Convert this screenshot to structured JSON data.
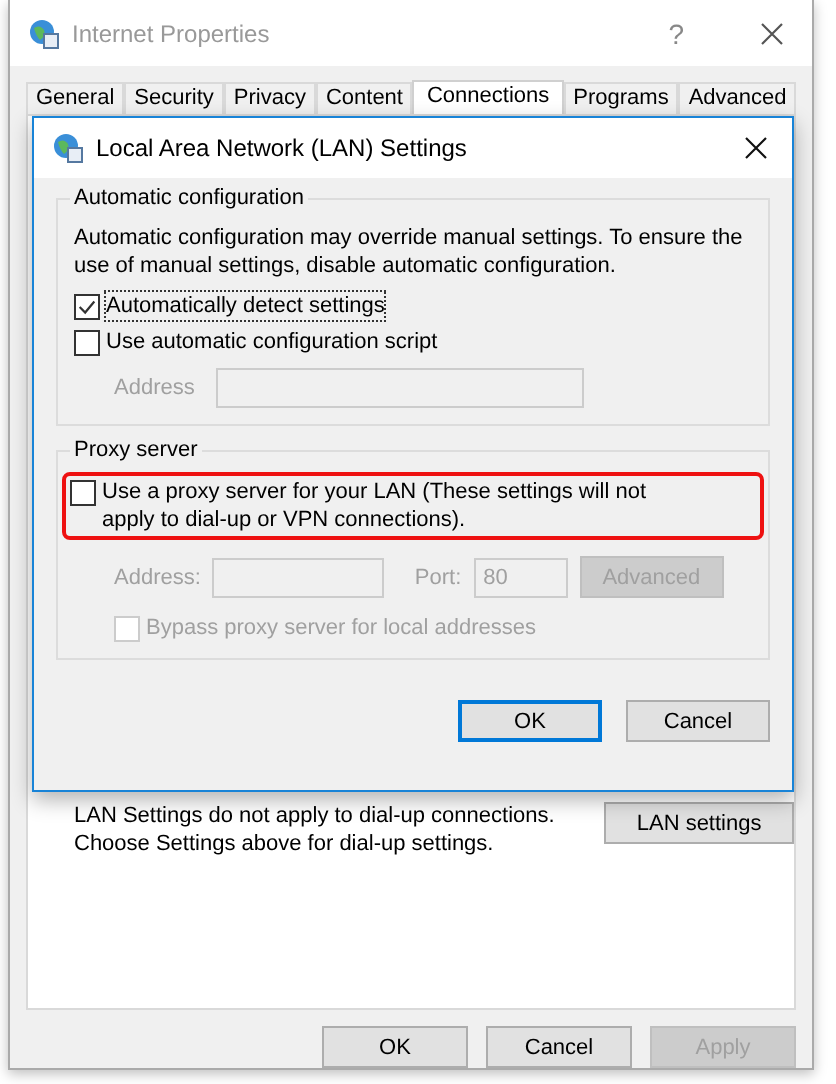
{
  "window": {
    "title": "Internet Properties",
    "help": "?"
  },
  "tabs": [
    {
      "label": "General",
      "selected": false
    },
    {
      "label": "Security",
      "selected": false
    },
    {
      "label": "Privacy",
      "selected": false
    },
    {
      "label": "Content",
      "selected": false
    },
    {
      "label": "Connections",
      "selected": true
    },
    {
      "label": "Programs",
      "selected": false
    },
    {
      "label": "Advanced",
      "selected": false
    }
  ],
  "panel": {
    "note": "LAN Settings do not apply to dial-up connections.\nChoose Settings above for dial-up settings.",
    "lan_button": "LAN settings"
  },
  "dialog": {
    "title": "Local Area Network (LAN) Settings",
    "auto_config": {
      "legend": "Automatic configuration",
      "description": "Automatic configuration may override manual settings.  To ensure the use of manual settings, disable automatic configuration.",
      "options": [
        {
          "label": "Automatically detect settings",
          "checked": true,
          "focused": true
        },
        {
          "label": "Use automatic configuration script",
          "checked": false,
          "focused": false
        }
      ],
      "address": {
        "label": "Address",
        "disabled": true
      }
    },
    "proxy": {
      "legend": "Proxy server",
      "option": {
        "label": "Use a proxy server for your LAN (These settings will not apply to dial-up or VPN connections).",
        "checked": false,
        "highlighted": true
      },
      "address": {
        "label": "Address:",
        "disabled": true
      },
      "port": {
        "label": "Port:",
        "value": "80",
        "disabled": true
      },
      "advanced": {
        "label": "Advanced",
        "disabled": true
      },
      "bypass": {
        "label": "Bypass proxy server for local addresses",
        "checked": false,
        "disabled": true
      }
    },
    "buttons": [
      {
        "label": "OK",
        "default": true
      },
      {
        "label": "Cancel",
        "default": false
      }
    ]
  },
  "buttons": [
    {
      "label": "OK",
      "disabled": false
    },
    {
      "label": "Cancel",
      "disabled": false
    },
    {
      "label": "Apply",
      "disabled": true
    }
  ]
}
